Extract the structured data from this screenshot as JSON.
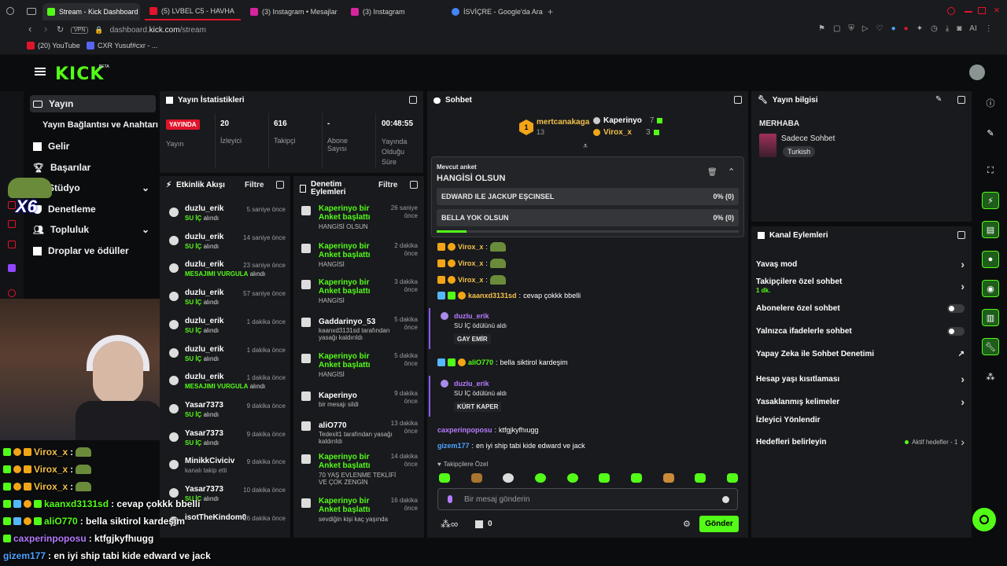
{
  "browser": {
    "tabs": [
      {
        "title": "Stream - Kick Dashboard",
        "icon": "kick-icon",
        "active": true
      },
      {
        "title": "(5) LVBEL C5 - HAVHA",
        "icon": "youtube-icon"
      },
      {
        "title": "(3) Instagram • Mesajlar",
        "icon": "instagram-icon"
      },
      {
        "title": "(3) Instagram",
        "icon": "instagram-icon"
      },
      {
        "title": "İSVİÇRE - Google'da Ara",
        "icon": "google-icon"
      }
    ],
    "url_domain": "dashboard.",
    "url_host": "kick.com",
    "url_path": "/stream",
    "vpn": "VPN",
    "extension_label": "AI",
    "bookmarks": [
      {
        "label": "(20) YouTube",
        "icon": "youtube-icon"
      },
      {
        "label": "CXR Yusuf#cxr - ...",
        "icon": "bookmark-icon"
      }
    ]
  },
  "header": {
    "logo": "KICK",
    "beta": "BETA"
  },
  "sidebar": {
    "items": [
      {
        "label": "Yayın",
        "icon": "broadcast-icon"
      },
      {
        "label": "Yayın Bağlantısı ve Anahtarı",
        "icon": ""
      },
      {
        "label": "Gelir",
        "icon": "chart-icon"
      },
      {
        "label": "Başarılar",
        "icon": "trophy-icon"
      },
      {
        "label": "Stüdyo",
        "icon": "studio-icon"
      },
      {
        "label": "Denetleme",
        "icon": "shield-icon"
      },
      {
        "label": "Topluluk",
        "icon": "people-icon"
      },
      {
        "label": "Droplar ve ödüller",
        "icon": "gift-icon"
      }
    ]
  },
  "stats": {
    "title": "Yayın İstatistikleri",
    "live_badge": "YAYINDA",
    "live_label": "Yayın",
    "viewers_value": "20",
    "viewers_label": "İzleyici",
    "followers_value": "616",
    "followers_label": "Takipçi",
    "subs_value": "-",
    "subs_label": "Abone Sayısı",
    "uptime_value": "00:48:55",
    "uptime_label": "Yayında Olduğu Süre"
  },
  "activity": {
    "title": "Etkinlik Akışı",
    "filter": "Filtre",
    "rows": [
      {
        "name": "duzlu_erik",
        "badge": "SU İÇ",
        "suffix": "alındı",
        "time": "5 saniye önce"
      },
      {
        "name": "duzlu_erik",
        "badge": "SU İÇ",
        "suffix": "alındı",
        "time": "14 saniye önce"
      },
      {
        "name": "duzlu_erik",
        "badge": "MESAJIMI VURGULA",
        "suffix": "alındı",
        "time": "23 saniye önce"
      },
      {
        "name": "duzlu_erik",
        "badge": "SU İÇ",
        "suffix": "alındı",
        "time": "57 saniye önce"
      },
      {
        "name": "duzlu_erik",
        "badge": "SU İÇ",
        "suffix": "alındı",
        "time": "1 dakika önce"
      },
      {
        "name": "duzlu_erik",
        "badge": "SU İÇ",
        "suffix": "alındı",
        "time": "1 dakika önce"
      },
      {
        "name": "duzlu_erik",
        "badge": "MESAJIMI VURGULA",
        "suffix": "alındı",
        "time": "1 dakika önce"
      },
      {
        "name": "Yasar7373",
        "badge": "SU İÇ",
        "suffix": "alındı",
        "time": "9 dakika önce"
      },
      {
        "name": "Yasar7373",
        "badge": "SU İÇ",
        "suffix": "alındı",
        "time": "9 dakika önce"
      },
      {
        "name": "MinikkCiviciv",
        "badge": "kanalı takip etti",
        "suffix": "",
        "time": "9 dakika önce"
      },
      {
        "name": "Yasar7373",
        "badge": "SU İÇ",
        "suffix": "alındı",
        "time": "10 dakika önce"
      },
      {
        "name": "isotTheKindom0",
        "badge": "",
        "suffix": "",
        "time": "26 dakika önce"
      }
    ]
  },
  "moderation": {
    "title": "Denetim Eylemleri",
    "filter": "Filtre",
    "rows": [
      {
        "name": "Kaperinyo bir Anket başlattı",
        "detail": "HANGİSİ OLSUN",
        "time": "26 saniye önce"
      },
      {
        "name": "Kaperinyo bir Anket başlattı",
        "detail": "HANGİSİ",
        "time": "2 dakika önce"
      },
      {
        "name": "Kaperinyo bir Anket başlattı",
        "detail": "HANGİSİ",
        "time": "3 dakika önce"
      },
      {
        "name": "Gaddarinyo_53",
        "detail": "kaanxd3131sd tarafından yasağı kaldırıldı",
        "time": "5 dakika önce"
      },
      {
        "name": "Kaperinyo bir Anket başlattı",
        "detail": "HANGİSİ",
        "time": "5 dakika önce"
      },
      {
        "name": "Kaperinyo",
        "detail": "bir mesajı sildi",
        "time": "9 dakika önce"
      },
      {
        "name": "aliO770",
        "detail": "Tedexit1 tarafından yasağı kaldırıldı",
        "time": "13 dakika önce"
      },
      {
        "name": "Kaperinyo bir Anket başlattı",
        "detail": "70 YAŞ EVLENME TEKLİFİ VE ÇOK ZENGİN",
        "time": "14 dakika önce"
      },
      {
        "name": "Kaperinyo bir Anket başlattı",
        "detail": "sevdiğin kişi kaç yaşında",
        "time": "16 dakika önce"
      }
    ]
  },
  "chat": {
    "title": "Sohbet",
    "top_gifter": {
      "name": "mertcanakaga",
      "count": "13",
      "rank": "1"
    },
    "gifters": [
      {
        "name": "Kaperinyo",
        "count": "7"
      },
      {
        "name": "Virox_x",
        "count": "3"
      }
    ],
    "poll": {
      "label": "Mevcut anket",
      "question": "HANGİSİ OLSUN",
      "options": [
        {
          "text": "EDWARD ILE JACKUP EŞCINSEL",
          "pct": "0% (0)"
        },
        {
          "text": "BELLA YOK OLSUN",
          "pct": "0% (0)"
        }
      ],
      "progress": 0.1
    },
    "messages": [
      {
        "user": "Virox_x",
        "text": ""
      },
      {
        "user": "Virox_x",
        "text": ""
      },
      {
        "user": "Virox_x",
        "text": ""
      },
      {
        "user": "kaanxd3131sd",
        "text": "cevap çokkk bbelli"
      }
    ],
    "reward1": {
      "user": "duzlu_erik",
      "line": "SU İÇ ödülünü aldı",
      "tag": "GAY EMİR"
    },
    "msg_ali": {
      "user": "aliO770",
      "text": "bella siktirol kardeşim"
    },
    "reward2": {
      "user": "duzlu_erik",
      "line": "SU İÇ ödülünü aldı",
      "tag": "KÜRT KAPER"
    },
    "msg_cax": {
      "user": "caxperinpoposu",
      "text": "ktfgjkyfhıugg"
    },
    "msg_giz": {
      "user": "gizem177",
      "text": "en iyi ship tabi kide edward ve jack"
    },
    "followers_only": "Takipçilere Özel",
    "placeholder": "Bir mesaj gönderin",
    "points": "0",
    "send": "Gönder"
  },
  "info": {
    "title": "Yayın bilgisi",
    "stream_title": "MERHABA",
    "category": "Sadece Sohbet",
    "language": "Turkish"
  },
  "actions": {
    "title": "Kanal Eylemleri",
    "slow": "Yavaş mod",
    "followers_chat": "Takipçilere özel sohbet",
    "followers_sub": "1 dk.",
    "subs_chat": "Abonelere özel sohbet",
    "emote_chat": "Yalnızca ifadelerle sohbet",
    "ai_mod": "Yapay Zeka ile Sohbet Denetimi",
    "age": "Hesap yaşı kısıtlaması",
    "banned_words": "Yasaklanmış kelimeler",
    "raid": "İzleyici Yönlendir",
    "goals": "Hedefleri belirleyin",
    "goals_active": "Aktif hedefler - 1"
  },
  "overlay": {
    "multiplier": "X6",
    "chat": [
      {
        "user": "Virox_x",
        "text": ":",
        "color": "#f2c14b"
      },
      {
        "user": "Virox_x",
        "text": ":",
        "color": "#f2c14b"
      },
      {
        "user": "Virox_x",
        "text": ":",
        "color": "#f2c14b"
      },
      {
        "user": "kaanxd3131sd",
        "text": ": cevap çokkk bbelli",
        "color": "#53fc18"
      },
      {
        "user": "aliO770",
        "text": ": bella siktirol kardeşim",
        "color": "#53fc18"
      },
      {
        "user": "caxperinpoposu",
        "text": ": ktfgjkyfhıugg",
        "color": "#b57cff"
      },
      {
        "user": "gizem177",
        "text": ": en iyi ship tabi kide edward ve jack",
        "color": "#4ea3ff"
      }
    ]
  }
}
